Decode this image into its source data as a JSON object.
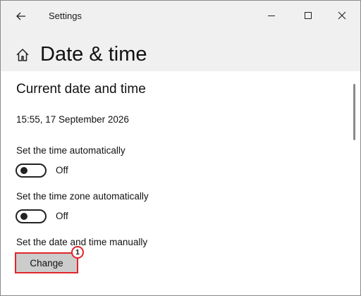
{
  "window": {
    "app_title": "Settings",
    "controls": [
      "minimize",
      "maximize",
      "close"
    ]
  },
  "header": {
    "page_title": "Date & time",
    "icon": "home-icon"
  },
  "section": {
    "title": "Current date and time",
    "current_datetime": "15:55, 17 September 2026"
  },
  "settings": {
    "auto_time_label": "Set the time automatically",
    "auto_time_state": "Off",
    "auto_timezone_label": "Set the time zone automatically",
    "auto_timezone_state": "Off",
    "manual_label": "Set the date and time manually",
    "change_button": "Change"
  },
  "annotation": {
    "step_number": "1",
    "highlight_color": "#e0262b"
  }
}
